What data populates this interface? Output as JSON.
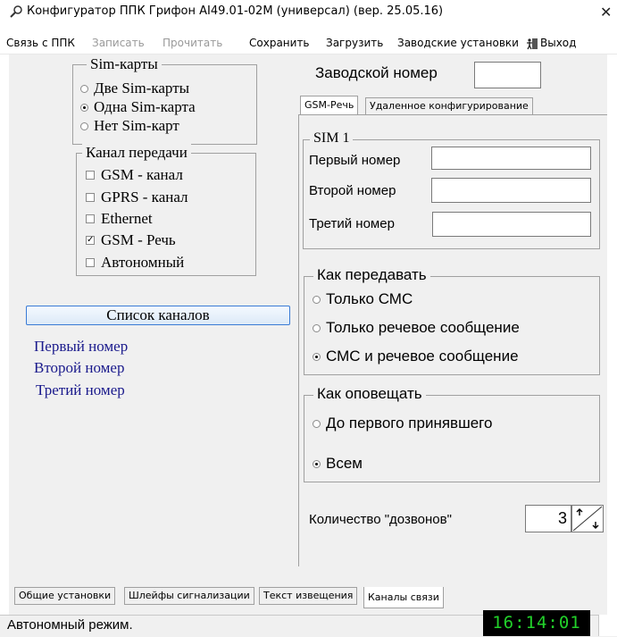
{
  "window": {
    "title": "Конфигуратор ППК Грифон AI49.01-02M (универсал) (вер. 25.05.16)"
  },
  "menu": {
    "items": [
      {
        "label": "Связь с ППК",
        "enabled": true
      },
      {
        "label": "Записать",
        "enabled": false
      },
      {
        "label": "Прочитать",
        "enabled": false
      },
      {
        "label": "Сохранить",
        "enabled": true
      },
      {
        "label": "Загрузить",
        "enabled": true
      },
      {
        "label": "Заводские установки",
        "enabled": true
      },
      {
        "label": "Выход",
        "enabled": true,
        "icon": "exit-icon"
      }
    ]
  },
  "sim_cards": {
    "legend": "Sim-карты",
    "options": [
      {
        "label": "Две Sim-карты",
        "selected": false
      },
      {
        "label": "Одна Sim-карта",
        "selected": true
      },
      {
        "label": "Нет Sim-карт",
        "selected": false
      }
    ]
  },
  "transmission_channel": {
    "legend": "Канал передачи",
    "options": [
      {
        "label": "GSM - канал",
        "checked": false
      },
      {
        "label": "GPRS - канал",
        "checked": false
      },
      {
        "label": "Ethernet",
        "checked": false
      },
      {
        "label": "GSM - Речь",
        "checked": true
      },
      {
        "label": "Автономный",
        "checked": false
      }
    ]
  },
  "channels_list_button": "Список каналов",
  "channel_numbers": [
    "Первый номер",
    "Второй номер",
    "Третий номер"
  ],
  "factory_number": {
    "label": "Заводской номер",
    "value": ""
  },
  "inner_tabs": [
    {
      "label": "GSM-Речь",
      "active": true
    },
    {
      "label": "Удаленное конфигурирование",
      "active": false
    }
  ],
  "sim1": {
    "legend": "SIM 1",
    "fields": [
      {
        "label": "Первый номер",
        "value": ""
      },
      {
        "label": "Второй номер",
        "value": ""
      },
      {
        "label": "Третий номер",
        "value": ""
      }
    ]
  },
  "how_to_send": {
    "legend": "Как передавать",
    "options": [
      {
        "label": "Только СМС",
        "selected": false
      },
      {
        "label": "Только речевое сообщение",
        "selected": false
      },
      {
        "label": "СМС и речевое сообщение",
        "selected": true
      }
    ]
  },
  "how_to_notify": {
    "legend": "Как оповещать",
    "options": [
      {
        "label": "До первого принявшего",
        "selected": false
      },
      {
        "label": "Всем",
        "selected": true
      }
    ]
  },
  "dial_count": {
    "label": "Количество \"дозвонов\"",
    "value": "3"
  },
  "bottom_tabs": [
    {
      "label": "Общие установки",
      "active": false
    },
    {
      "label": "Шлейфы сигнализации",
      "active": false
    },
    {
      "label": "Текст извещения",
      "active": false
    },
    {
      "label": "Каналы связи",
      "active": true
    }
  ],
  "status": {
    "text": "Автономный режим.",
    "clock": "16:14:01"
  },
  "colors": {
    "titlebar": "#ffffff",
    "panel": "#f0f0f0",
    "accent_blue": "#1a1a8c",
    "clock_fg": "#22d12a",
    "clock_bg": "#000000"
  }
}
